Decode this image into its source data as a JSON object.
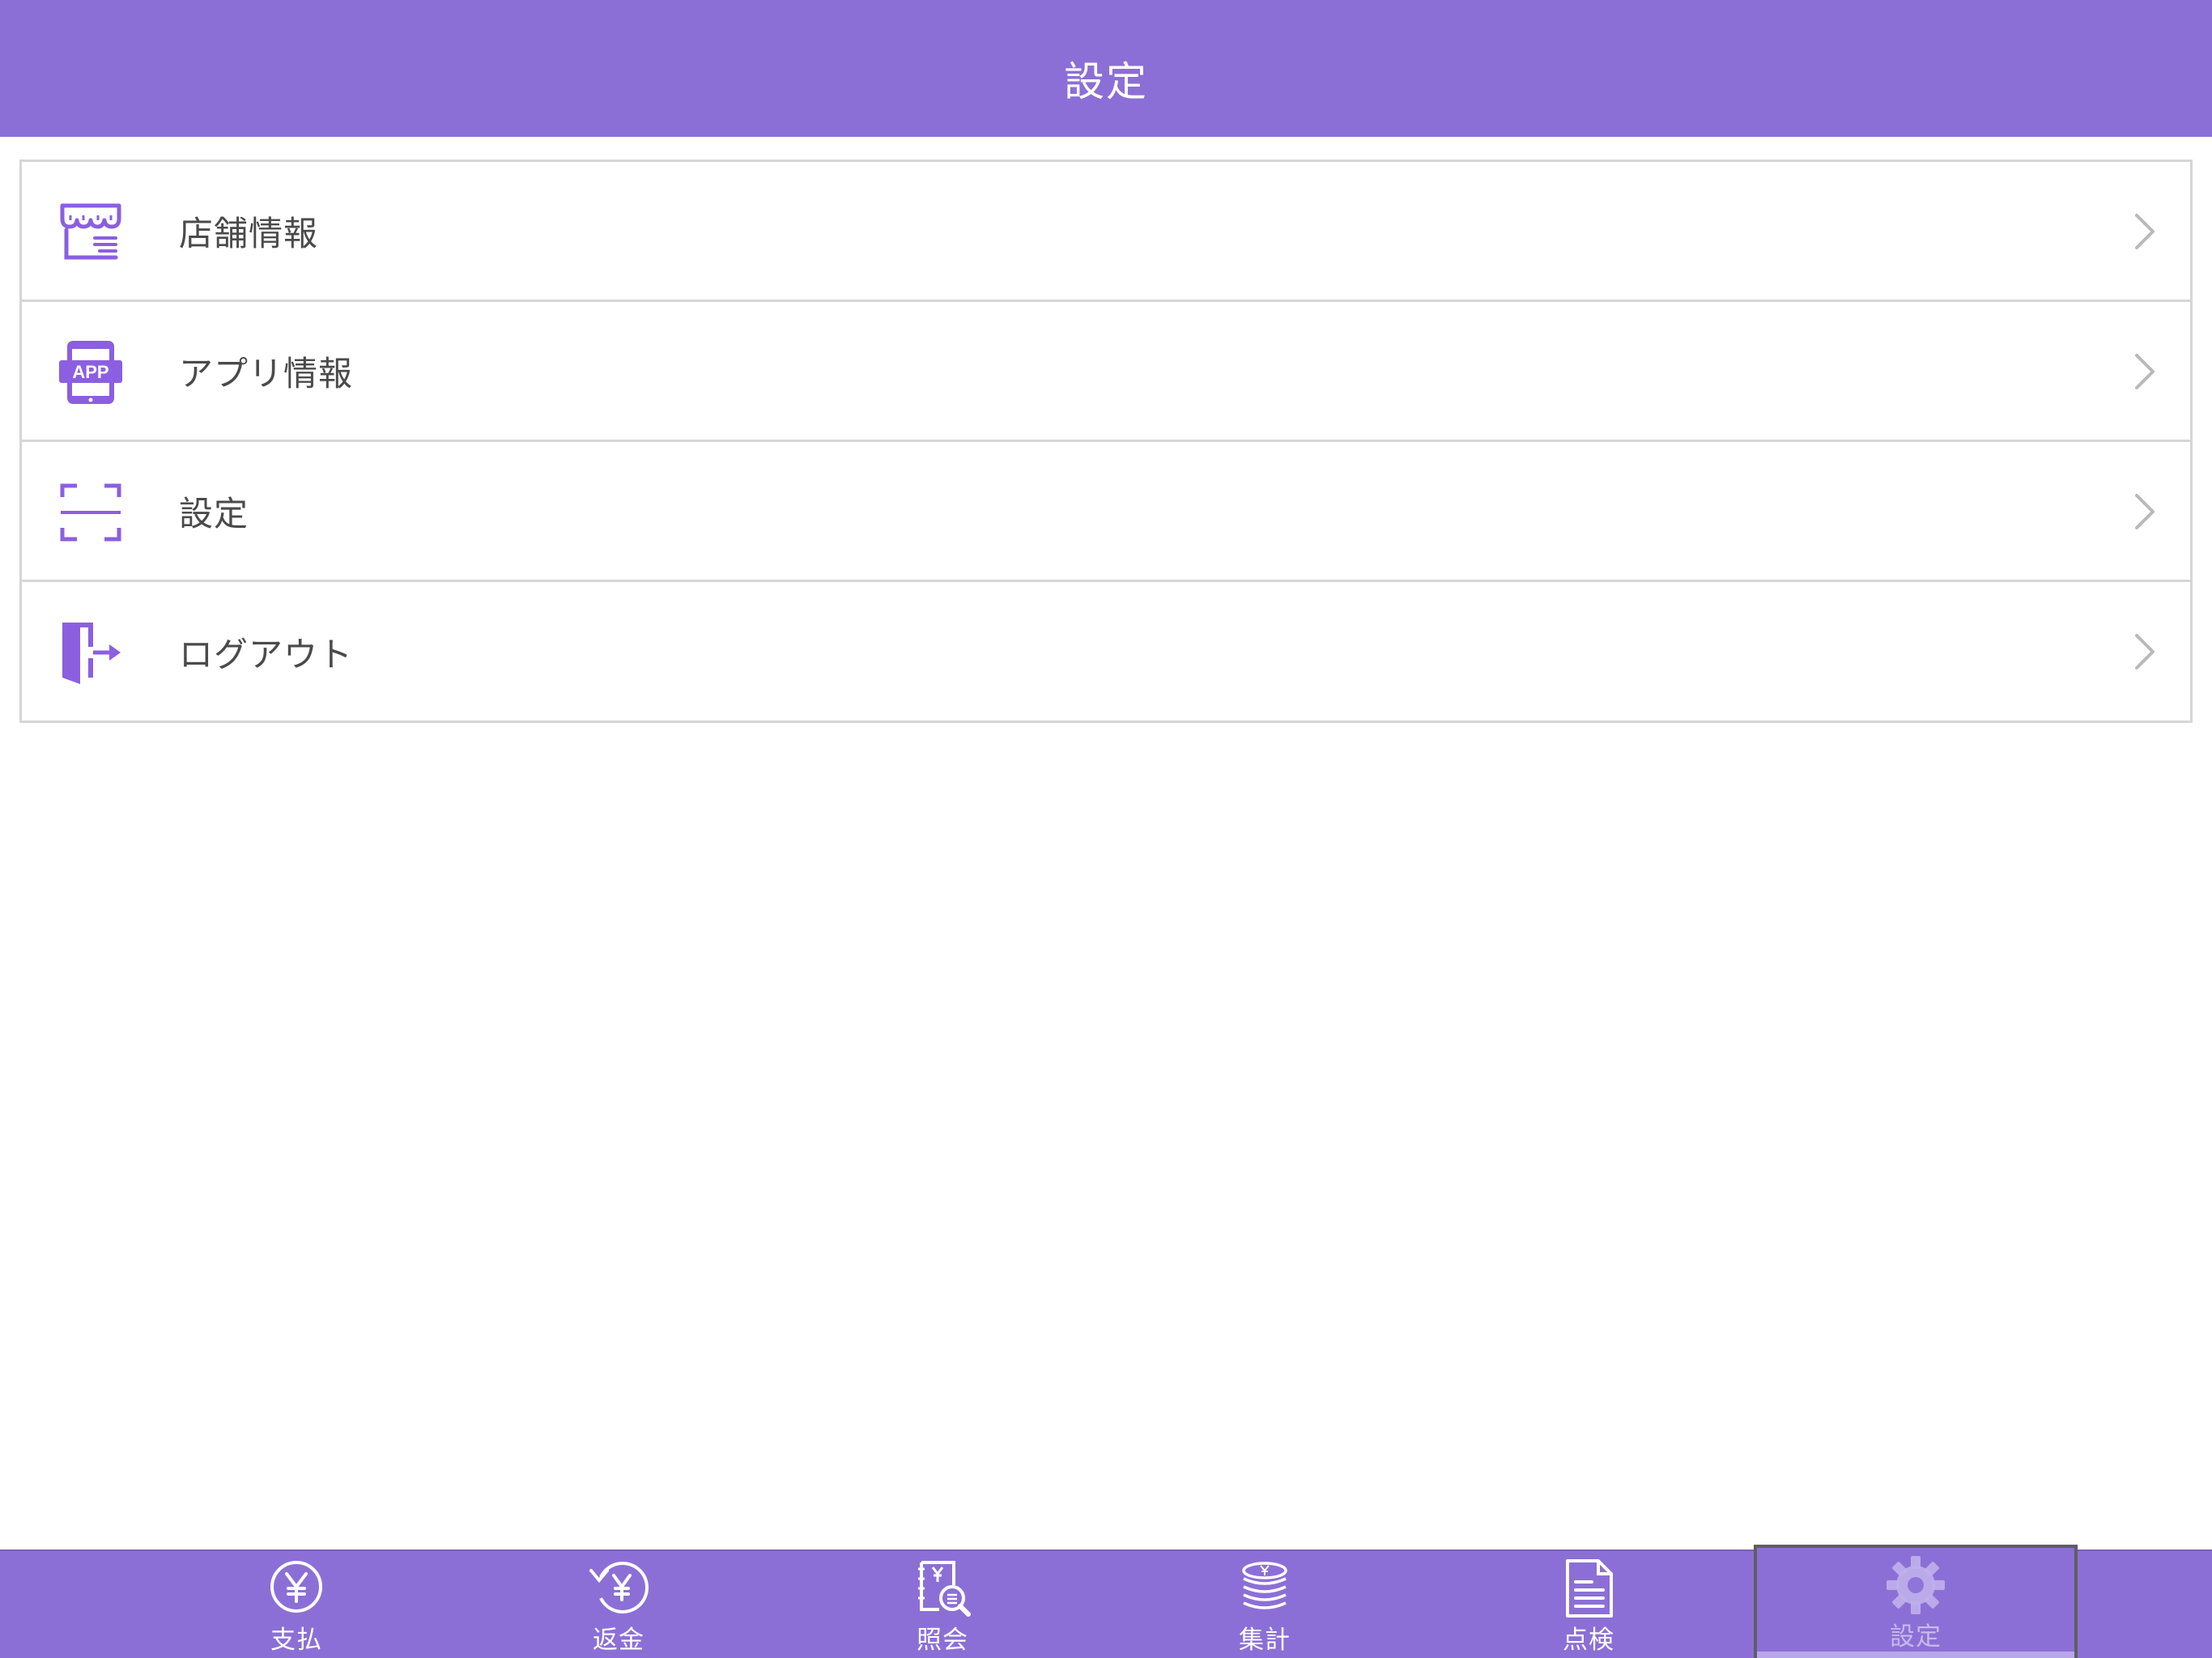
{
  "header": {
    "title": "設定"
  },
  "menu": {
    "items": [
      {
        "label": "店舗情報",
        "icon": "store-icon"
      },
      {
        "label": "アプリ情報",
        "icon": "app-info-icon"
      },
      {
        "label": "設定",
        "icon": "scan-frame-icon"
      },
      {
        "label": "ログアウト",
        "icon": "logout-icon"
      }
    ]
  },
  "tabbar": {
    "tabs": [
      {
        "label": "支払",
        "icon": "yen-circle-icon"
      },
      {
        "label": "返金",
        "icon": "refund-yen-icon"
      },
      {
        "label": "照会",
        "icon": "search-receipt-icon"
      },
      {
        "label": "集計",
        "icon": "coin-stack-icon"
      },
      {
        "label": "点検",
        "icon": "document-icon"
      },
      {
        "label": "設定",
        "icon": "gear-icon"
      }
    ],
    "active_index": 5
  },
  "colors": {
    "accent": "#8c6fd6",
    "icon_purple": "#8b5fe0",
    "divider": "#d6d6d6",
    "label_text": "#4a4a4a",
    "chevron": "#b9b9b9",
    "active_tab_label": "#c7b8ee"
  }
}
